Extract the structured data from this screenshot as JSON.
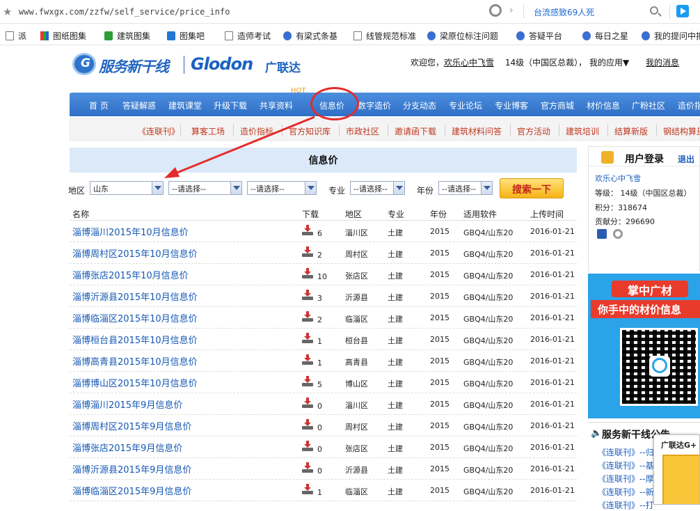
{
  "browser": {
    "url": "www.fwxgx.com/zzfw/self_service/price_info",
    "news_text": "台流感致69人死"
  },
  "bookmarks": [
    "派",
    "图纸图集",
    "建筑图集",
    "图集吧",
    "造师考试",
    "有梁式条基",
    "线管规范标准",
    "梁原位标注问题",
    "答疑平台",
    "每日之星",
    "我的提问中扣"
  ],
  "header": {
    "logo_cn": "服务新干线",
    "logo_en": "Glodon",
    "logo_brand": "广联达",
    "welcome_prefix": "欢迎您，",
    "username": "欢乐心中飞雪",
    "level": "14级（中国区总裁）",
    "my_apps": "我的应用▼",
    "my_messages": "我的消息"
  },
  "nav_main": [
    "首 页",
    "答疑解惑",
    "建筑课堂",
    "升级下载",
    "共享资料",
    "信息价",
    "数字造价",
    "分支动态",
    "专业论坛",
    "专业博客",
    "官方商城",
    "材价信息",
    "广粉社区",
    "造价指"
  ],
  "nav_hot": "HOT",
  "nav_sub": [
    "《连联刊》",
    "算客工场",
    "造价指标",
    "官方知识库",
    "市政社区",
    "邀请函下载",
    "建筑材料问答",
    "官方活动",
    "建筑培训",
    "结算新版",
    "钢结构算量"
  ],
  "page_title": "信息价",
  "filters": {
    "region_label": "地区",
    "region_value": "山东",
    "city_value": "--请选择--",
    "district_value": "--请选择--",
    "major_label": "专业",
    "major_value": "--请选择--",
    "year_label": "年份",
    "year_value": "--请选择--",
    "search_button": "搜索一下"
  },
  "table": {
    "headers": [
      "名称",
      "下载",
      "地区",
      "专业",
      "年份",
      "适用软件",
      "上传时间"
    ],
    "rows": [
      {
        "name": "淄博淄川2015年10月信息价",
        "downloads": "6",
        "region": "淄川区",
        "major": "土建",
        "year": "2015",
        "software": "GBQ4/山东20",
        "date": "2016-01-21"
      },
      {
        "name": "淄博周村区2015年10月信息价",
        "downloads": "2",
        "region": "周村区",
        "major": "土建",
        "year": "2015",
        "software": "GBQ4/山东20",
        "date": "2016-01-21"
      },
      {
        "name": "淄博张店2015年10月信息价",
        "downloads": "10",
        "region": "张店区",
        "major": "土建",
        "year": "2015",
        "software": "GBQ4/山东20",
        "date": "2016-01-21"
      },
      {
        "name": "淄博沂源县2015年10月信息价",
        "downloads": "3",
        "region": "沂源县",
        "major": "土建",
        "year": "2015",
        "software": "GBQ4/山东20",
        "date": "2016-01-21"
      },
      {
        "name": "淄博临淄区2015年10月信息价",
        "downloads": "2",
        "region": "临淄区",
        "major": "土建",
        "year": "2015",
        "software": "GBQ4/山东20",
        "date": "2016-01-21"
      },
      {
        "name": "淄博桓台县2015年10月信息价",
        "downloads": "1",
        "region": "桓台县",
        "major": "土建",
        "year": "2015",
        "software": "GBQ4/山东20",
        "date": "2016-01-21"
      },
      {
        "name": "淄博高青县2015年10月信息价",
        "downloads": "1",
        "region": "高青县",
        "major": "土建",
        "year": "2015",
        "software": "GBQ4/山东20",
        "date": "2016-01-21"
      },
      {
        "name": "淄博博山区2015年10月信息价",
        "downloads": "5",
        "region": "博山区",
        "major": "土建",
        "year": "2015",
        "software": "GBQ4/山东20",
        "date": "2016-01-21"
      },
      {
        "name": "淄博淄川2015年9月信息价",
        "downloads": "0",
        "region": "淄川区",
        "major": "土建",
        "year": "2015",
        "software": "GBQ4/山东20",
        "date": "2016-01-21"
      },
      {
        "name": "淄博周村区2015年9月信息价",
        "downloads": "0",
        "region": "周村区",
        "major": "土建",
        "year": "2015",
        "software": "GBQ4/山东20",
        "date": "2016-01-21"
      },
      {
        "name": "淄博张店2015年9月信息价",
        "downloads": "0",
        "region": "张店区",
        "major": "土建",
        "year": "2015",
        "software": "GBQ4/山东20",
        "date": "2016-01-21"
      },
      {
        "name": "淄博沂源县2015年9月信息价",
        "downloads": "0",
        "region": "沂源县",
        "major": "土建",
        "year": "2015",
        "software": "GBQ4/山东20",
        "date": "2016-01-21"
      },
      {
        "name": "淄博临淄区2015年9月信息价",
        "downloads": "1",
        "region": "临淄区",
        "major": "土建",
        "year": "2015",
        "software": "GBQ4/山东20",
        "date": "2016-01-21"
      }
    ]
  },
  "login_panel": {
    "title": "用户登录",
    "logout": "退出",
    "username": "欢乐心中飞雪",
    "level": "等级： 14级（中国区总裁）",
    "points": "积分：318674",
    "contribution": "贡献分：296690"
  },
  "ad": {
    "headline": "掌中广材",
    "subline": "你手中的材价信息"
  },
  "news": {
    "title": "服务新干线公告",
    "items": [
      "《连联刊》--归",
      "《连联刊》--基",
      "《连联刊》--厚",
      "《连联刊》--新",
      "《连联刊》--打"
    ]
  },
  "popup": {
    "title": "广联达G+"
  }
}
